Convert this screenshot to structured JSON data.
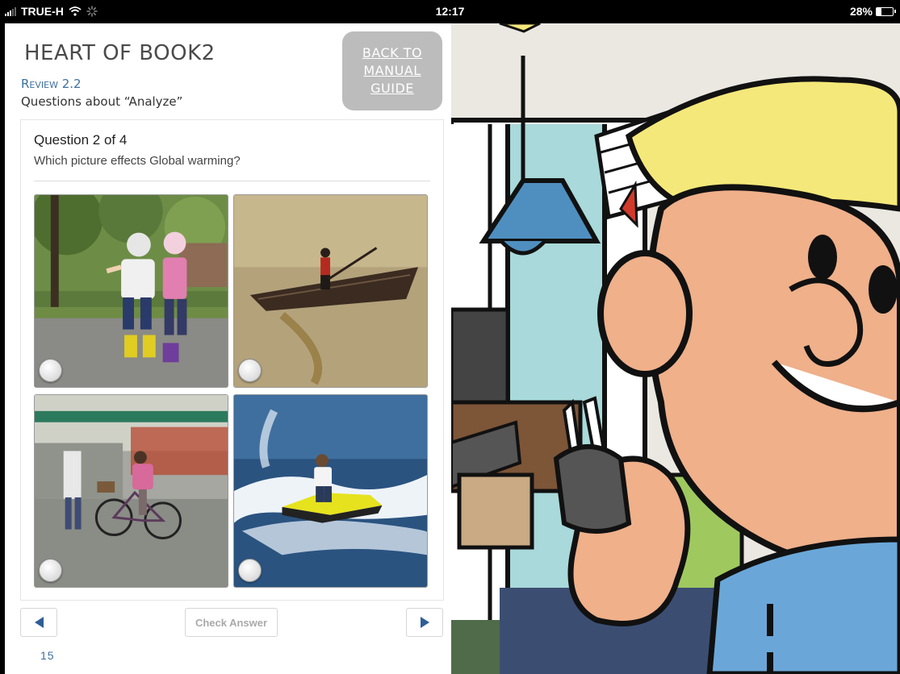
{
  "status_bar": {
    "carrier": "TRUE-H",
    "time": "12:17",
    "battery": "28%",
    "battery_level": 0.28
  },
  "book": {
    "title": "HEART OF BOOK2",
    "section": "Review 2.2",
    "subtitle": "Questions about “Analyze”",
    "back_button": [
      "BACK TO",
      "MANUAL",
      "GUIDE"
    ]
  },
  "quiz": {
    "counter": "Question 2 of 4",
    "question": "Which picture effects Global warming?",
    "options": [
      {
        "name": "kids-rollerskating-photo",
        "selected": false
      },
      {
        "name": "rowboat-photo",
        "selected": false
      },
      {
        "name": "bicycle-photo",
        "selected": false
      },
      {
        "name": "jetski-photo",
        "selected": false
      }
    ],
    "prev_icon": "triangle-left-icon",
    "next_icon": "triangle-right-icon",
    "check_label": "Check Answer"
  },
  "page_number": "15",
  "colors": {
    "accent": "#3f6f9e",
    "button_gray": "#bcbcbc"
  }
}
